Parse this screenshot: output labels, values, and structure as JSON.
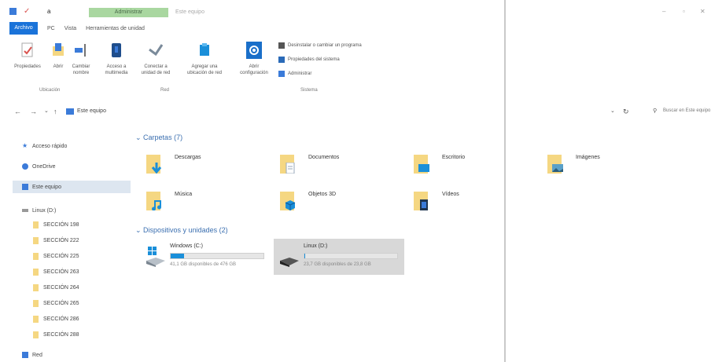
{
  "titlebar": {
    "quick_access_letter": "a",
    "context_tab": "Administrar",
    "title": "Este equipo"
  },
  "ribbon_tabs": [
    "Archivo",
    "PC",
    "Vista",
    "Herramientas de unidad"
  ],
  "ribbon": {
    "buttons": [
      {
        "label": "Propiedades",
        "icon": "properties-icon"
      },
      {
        "label": "Abrir",
        "icon": "open-icon"
      },
      {
        "label": "Cambiar nombre",
        "icon": "rename-icon"
      },
      {
        "label": "Acceso a multimedia",
        "icon": "media-access-icon"
      },
      {
        "label": "Conectar a unidad de red",
        "icon": "map-drive-icon"
      },
      {
        "label": "Agregar una ubicación de red",
        "icon": "network-location-icon"
      },
      {
        "label": "Abrir configuración",
        "icon": "settings-icon"
      }
    ],
    "small_buttons": [
      "Desinstalar o cambiar un programa",
      "Propiedades del sistema",
      "Administrar"
    ],
    "groups": [
      "Ubicación",
      "Red",
      "Sistema"
    ]
  },
  "address": {
    "path": "Este equipo",
    "search_placeholder": "Buscar en Este equipo"
  },
  "sidebar": {
    "items": [
      {
        "label": "Acceso rápido",
        "icon": "star-icon"
      },
      {
        "label": "OneDrive",
        "icon": "cloud-icon"
      },
      {
        "label": "Este equipo",
        "icon": "computer-icon",
        "selected": true
      },
      {
        "label": "Linux (D:)",
        "icon": "drive-icon"
      }
    ],
    "folders": [
      "SECCIÓN 198",
      "SECCIÓN 222",
      "SECCIÓN 225",
      "SECCIÓN 263",
      "SECCIÓN 264",
      "SECCIÓN 265",
      "SECCIÓN 286",
      "SECCIÓN 288"
    ],
    "network": "Red"
  },
  "content": {
    "folders_title": "Carpetas (7)",
    "folders": [
      {
        "label": "Descargas",
        "icon": "download-icon"
      },
      {
        "label": "Documentos",
        "icon": "document-icon"
      },
      {
        "label": "Escritorio",
        "icon": "desktop-icon"
      },
      {
        "label": "Imágenes",
        "icon": "pictures-icon"
      },
      {
        "label": "Música",
        "icon": "music-icon"
      },
      {
        "label": "Objetos 3D",
        "icon": "3d-objects-icon"
      },
      {
        "label": "Vídeos",
        "icon": "videos-icon"
      }
    ],
    "drives_title": "Dispositivos y unidades (2)",
    "drives": [
      {
        "name": "Windows (C:)",
        "info": "41,1 GB disponibles de 476 GB",
        "used_fraction": 0.14
      },
      {
        "name": "Linux (D:)",
        "info": "23,7 GB disponibles de 23,8 GB",
        "used_fraction": 0.01
      }
    ]
  },
  "colors": {
    "accent": "#1a73d9",
    "folder": "#f5d782",
    "context_tab": "#a9d7a0"
  }
}
